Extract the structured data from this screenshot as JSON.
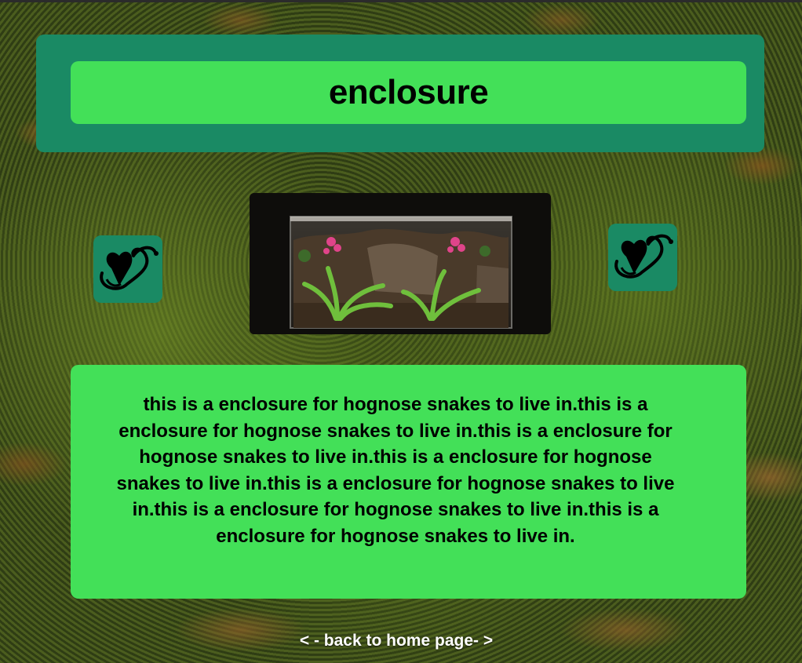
{
  "header": {
    "title": "enclosure"
  },
  "icons": {
    "left": "snake-heart-icon",
    "right": "snake-heart-icon"
  },
  "media": {
    "photo": "terrarium-photo"
  },
  "colors": {
    "panel_dark": "#1a8a64",
    "panel_light": "#43e058",
    "text": "#000000",
    "link": "#ffffff"
  },
  "description": {
    "text": "this is a enclosure for hognose snakes to live in.this is a enclosure for hognose snakes to live in.this is a enclosure for hognose snakes to live in.this is a enclosure for hognose snakes to live in.this is a enclosure for hognose snakes to live in.this is a enclosure for hognose snakes to live in.this is a enclosure for hognose snakes to live in."
  },
  "nav": {
    "back_link": "< - back to home page- >"
  }
}
